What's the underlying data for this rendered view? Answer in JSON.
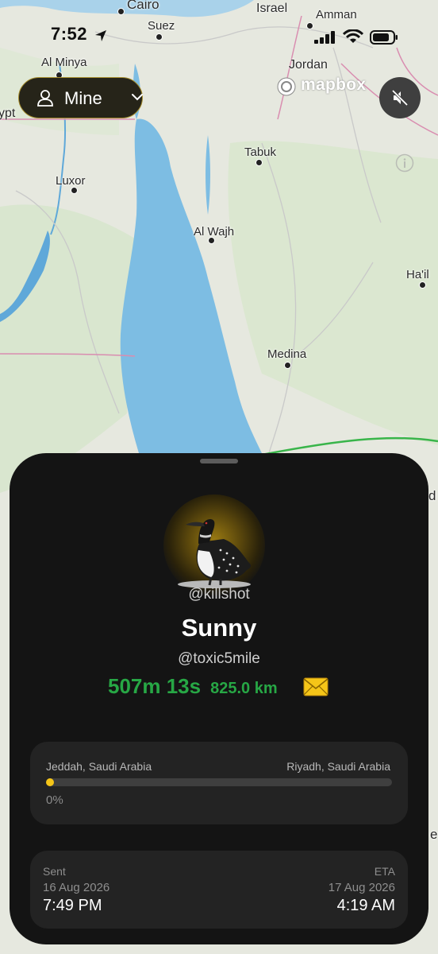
{
  "status_bar": {
    "time": "7:52"
  },
  "filter": {
    "label": "Mine"
  },
  "map": {
    "attribution": "mapbox",
    "places": [
      "Cairo",
      "Israel",
      "Amman",
      "Suez",
      "Al Minya",
      "Jordan",
      "ypt",
      "Luxor",
      "Tabuk",
      "Al Wajh",
      "Ha'il",
      "Medina",
      "d",
      "e"
    ]
  },
  "bird": {
    "owner_handle": "@killshot",
    "name": "Sunny",
    "recipient_handle": "@toxic5mile",
    "duration": "507m 13s",
    "distance": "825.0 km"
  },
  "route": {
    "from": "Jeddah, Saudi Arabia",
    "to": "Riyadh, Saudi Arabia",
    "progress_percent": 0,
    "progress_label": "0%"
  },
  "times": {
    "sent_label": "Sent",
    "sent_date": "16 Aug 2026",
    "sent_time": "7:49 PM",
    "eta_label": "ETA",
    "eta_date": "17 Aug 2026",
    "eta_time": "4:19 AM"
  },
  "colors": {
    "accent_green": "#27a745",
    "progress_yellow": "#f5c518",
    "sheet_bg": "#141414"
  }
}
